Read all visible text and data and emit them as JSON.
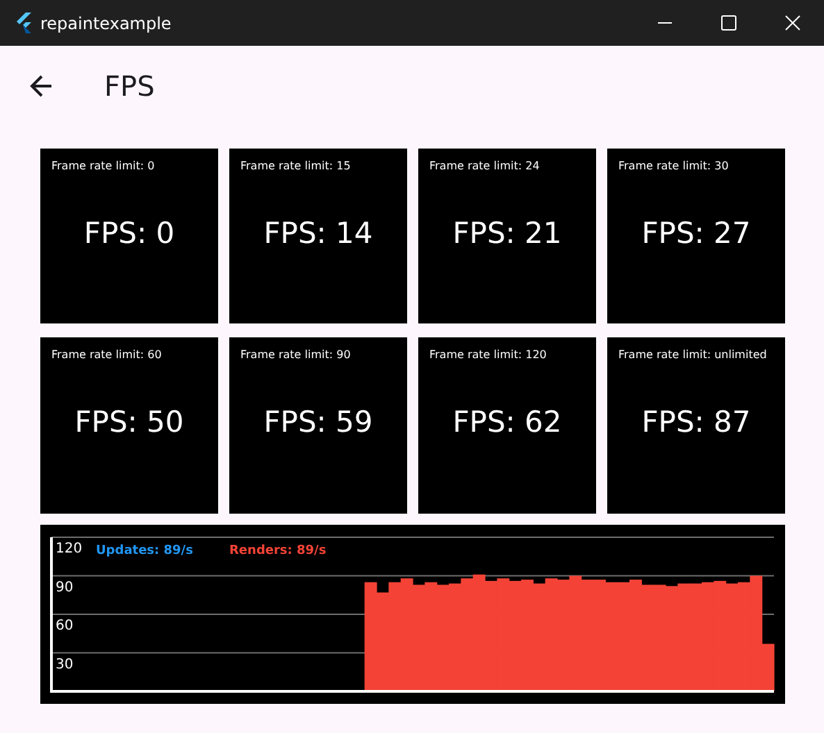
{
  "window": {
    "title": "repaintexample"
  },
  "app_bar": {
    "title": "FPS"
  },
  "tiles": [
    {
      "limit": "Frame rate limit: 0",
      "fps": "FPS: 0"
    },
    {
      "limit": "Frame rate limit: 15",
      "fps": "FPS: 14"
    },
    {
      "limit": "Frame rate limit: 24",
      "fps": "FPS: 21"
    },
    {
      "limit": "Frame rate limit: 30",
      "fps": "FPS: 27"
    },
    {
      "limit": "Frame rate limit: 60",
      "fps": "FPS: 50"
    },
    {
      "limit": "Frame rate limit: 90",
      "fps": "FPS: 59"
    },
    {
      "limit": "Frame rate limit: 120",
      "fps": "FPS: 62"
    },
    {
      "limit": "Frame rate limit: unlimited",
      "fps": "FPS: 87"
    }
  ],
  "graph": {
    "stats": [
      {
        "text": "Updates: 89/s",
        "color": "#2196f3"
      },
      {
        "text": "Renders: 89/s",
        "color": "#f44336"
      }
    ],
    "chart_data": {
      "type": "bar",
      "ylim": [
        0,
        120
      ],
      "yticks": [
        30,
        60,
        90,
        120
      ],
      "grid": true,
      "series": [
        {
          "color": "#f44336",
          "values": [
            null,
            null,
            null,
            null,
            null,
            null,
            null,
            null,
            null,
            null,
            null,
            null,
            null,
            null,
            null,
            null,
            null,
            null,
            null,
            null,
            null,
            null,
            null,
            null,
            null,
            null,
            85,
            77,
            85,
            88,
            83,
            85,
            83,
            84,
            88,
            91,
            86,
            88,
            86,
            87,
            84,
            88,
            87,
            90,
            87,
            87,
            85,
            85,
            87,
            83,
            83,
            82,
            84,
            84,
            85,
            86,
            84,
            85,
            90,
            37
          ]
        }
      ]
    }
  }
}
